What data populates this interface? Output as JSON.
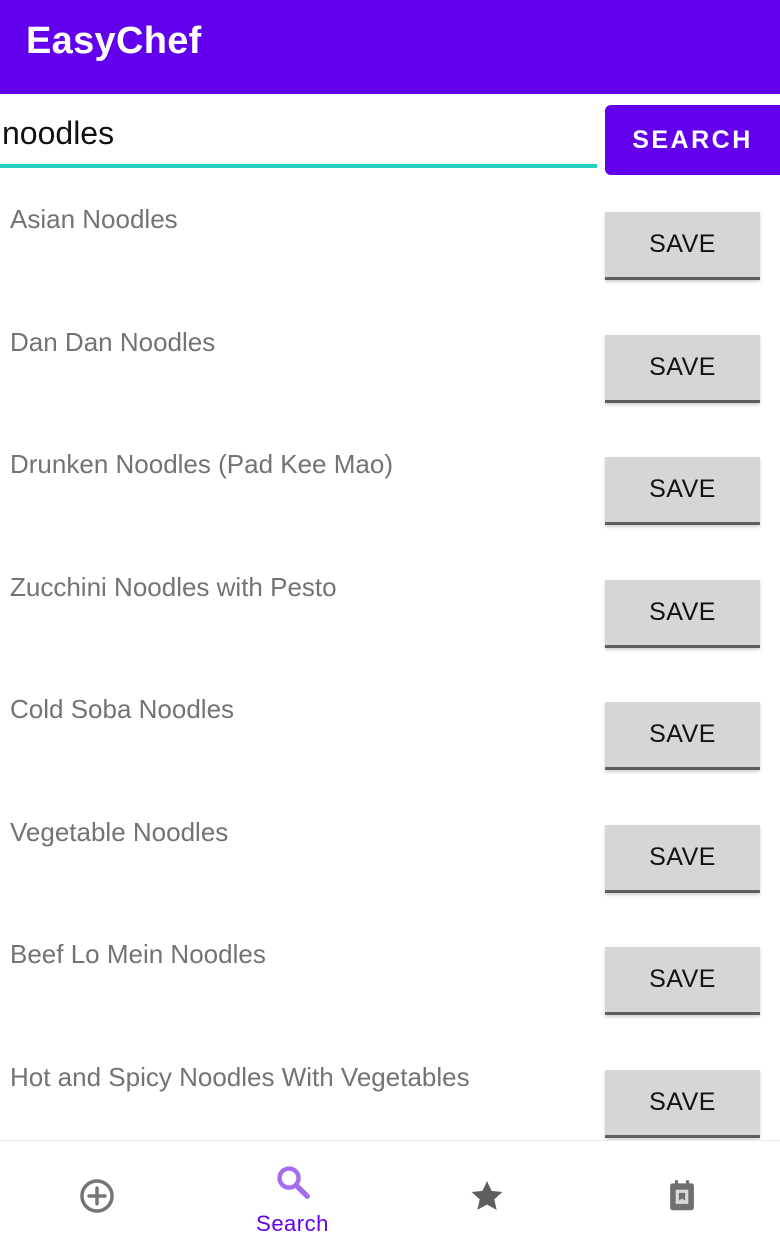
{
  "app": {
    "title": "EasyChef"
  },
  "search": {
    "value": "noodles",
    "button_label": "SEARCH"
  },
  "results": [
    {
      "name": "Asian Noodles",
      "save_label": "SAVE"
    },
    {
      "name": "Dan Dan Noodles",
      "save_label": "SAVE"
    },
    {
      "name": "Drunken Noodles (Pad Kee Mao)",
      "save_label": "SAVE"
    },
    {
      "name": "Zucchini Noodles with Pesto",
      "save_label": "SAVE"
    },
    {
      "name": "Cold Soba Noodles",
      "save_label": "SAVE"
    },
    {
      "name": "Vegetable Noodles",
      "save_label": "SAVE"
    },
    {
      "name": "Beef Lo Mein Noodles",
      "save_label": "SAVE"
    },
    {
      "name": "Hot and Spicy Noodles With Vegetables",
      "save_label": "SAVE"
    }
  ],
  "bottom_nav": {
    "items": [
      {
        "icon": "add-circle-icon",
        "label": ""
      },
      {
        "icon": "search-icon",
        "label": "Search",
        "active": true
      },
      {
        "icon": "star-icon",
        "label": ""
      },
      {
        "icon": "recipe-book-icon",
        "label": ""
      }
    ]
  },
  "colors": {
    "primary": "#6200ee",
    "accent": "#26d0c1",
    "button_gray": "#d6d6d6",
    "icon_inactive": "#757575",
    "icon_active": "#a66cf0"
  }
}
